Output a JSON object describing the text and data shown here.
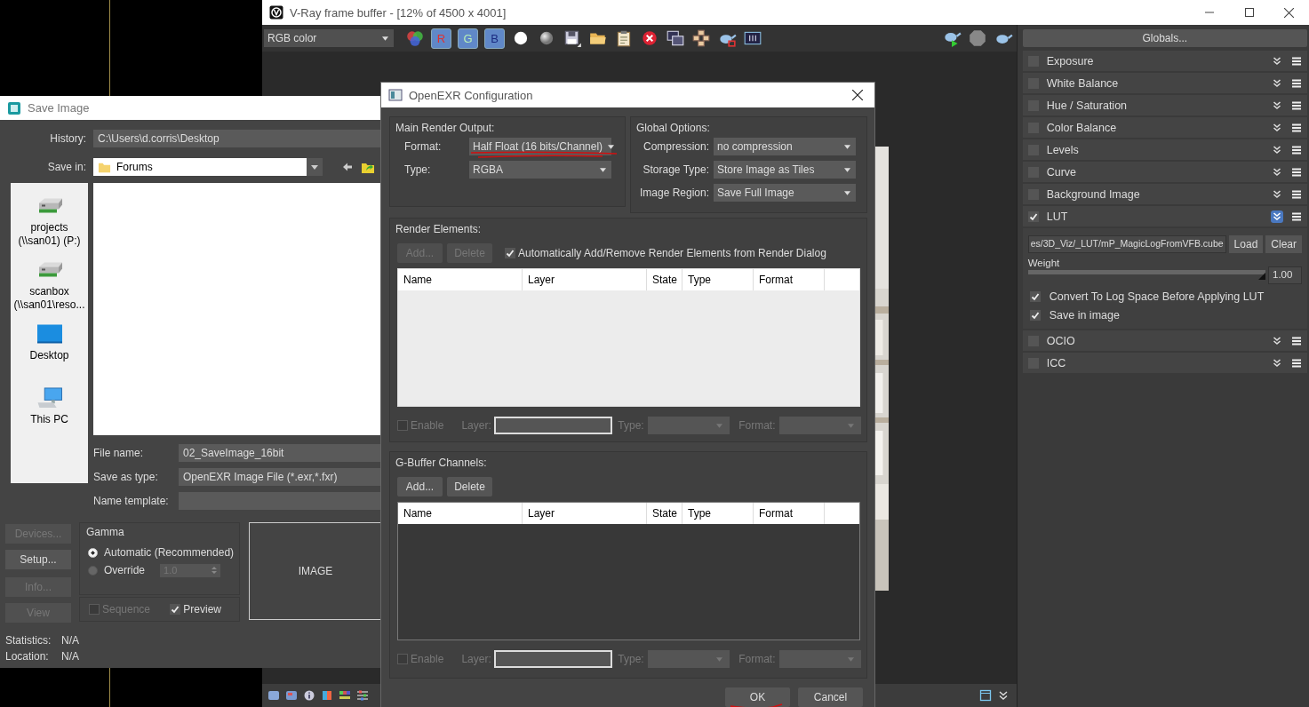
{
  "vfb": {
    "title": "V-Ray frame buffer - [12% of 4500 x 4001]",
    "channel_select": "RGB color",
    "channel_buttons": [
      {
        "label": "R",
        "selected": true
      },
      {
        "label": "G",
        "selected": true
      },
      {
        "label": "B",
        "selected": true
      }
    ],
    "globals_button": "Globals...",
    "layers": [
      {
        "label": "Exposure",
        "checked": false,
        "expanded": false
      },
      {
        "label": "White Balance",
        "checked": false,
        "expanded": false
      },
      {
        "label": "Hue / Saturation",
        "checked": false,
        "expanded": false
      },
      {
        "label": "Color Balance",
        "checked": false,
        "expanded": false
      },
      {
        "label": "Levels",
        "checked": false,
        "expanded": false
      },
      {
        "label": "Curve",
        "checked": false,
        "expanded": false
      },
      {
        "label": "Background Image",
        "checked": false,
        "expanded": false
      },
      {
        "label": "LUT",
        "checked": true,
        "expanded": true
      },
      {
        "label": "OCIO",
        "checked": false,
        "expanded": false
      },
      {
        "label": "ICC",
        "checked": false,
        "expanded": false
      }
    ],
    "lut": {
      "path": "es/3D_Viz/_LUT/mP_MagicLogFromVFB.cube",
      "load": "Load",
      "clear": "Clear",
      "weight_label": "Weight",
      "level": 1.0,
      "weight_value": "1.00",
      "options": [
        {
          "label": "Convert To Log Space Before Applying LUT",
          "checked": true
        },
        {
          "label": "Save in image",
          "checked": true
        }
      ]
    }
  },
  "save_image": {
    "title": "Save Image",
    "history_label": "History:",
    "history": "C:\\Users\\d.corris\\Desktop",
    "save_in_label": "Save in:",
    "save_in": "Forums",
    "places": [
      {
        "kind": "drive",
        "label": "projects",
        "sublabel": "(\\\\san01) (P:)"
      },
      {
        "kind": "drive",
        "label": "scanbox",
        "sublabel": "(\\\\san01\\reso..."
      },
      {
        "kind": "desktop",
        "label": "Desktop"
      },
      {
        "kind": "pc",
        "label": "This PC"
      }
    ],
    "file_name_label": "File name:",
    "file_name": "02_SaveImage_16bit",
    "save_as_type_label": "Save as type:",
    "save_as_type": "OpenEXR Image File (*.exr,*.fxr)",
    "name_template_label": "Name template:",
    "side_buttons": [
      {
        "label": "Devices...",
        "disabled": true
      },
      {
        "label": "Setup...",
        "disabled": false
      },
      {
        "label": "Info...",
        "disabled": true
      },
      {
        "label": "View",
        "disabled": true
      }
    ],
    "gamma": {
      "title": "Gamma",
      "options": [
        {
          "label": "Automatic (Recommended)",
          "selected": true
        },
        {
          "label": "Override",
          "selected": false
        }
      ],
      "override_value": "1.0"
    },
    "sequence": {
      "label": "Sequence",
      "checked": false,
      "disabled": true
    },
    "preview": {
      "label": "Preview",
      "checked": true,
      "disabled": false
    },
    "image_preview": "IMAGE",
    "info": [
      {
        "label": "Statistics:",
        "value": "N/A"
      },
      {
        "label": "Location:",
        "value": "N/A"
      }
    ]
  },
  "openexr": {
    "title": "OpenEXR Configuration",
    "main_output": {
      "title": "Main Render Output:",
      "fields": [
        {
          "label": "Format:",
          "value": "Half Float (16 bits/Channel)",
          "marked": true
        },
        {
          "label": "Type:",
          "value": "RGBA",
          "marked": false
        }
      ]
    },
    "global_options": {
      "title": "Global Options:",
      "fields": [
        {
          "label": "Compression:",
          "value": "no compression"
        },
        {
          "label": "Storage Type:",
          "value": "Store Image as Tiles"
        },
        {
          "label": "Image Region:",
          "value": "Save Full Image"
        }
      ]
    },
    "sections": [
      {
        "kind": "elements",
        "title": "Render Elements:",
        "buttons": [
          {
            "label": "Add...",
            "disabled": true
          },
          {
            "label": "Delete",
            "disabled": true
          }
        ],
        "auto_add": {
          "label": "Automatically Add/Remove Render Elements from Render Dialog",
          "checked": true
        },
        "columns": [
          "Name",
          "Layer",
          "State",
          "Type",
          "Format"
        ],
        "editor": {
          "enable": "Enable",
          "enable_checked": false,
          "layer_label": "Layer:",
          "type_label": "Type:",
          "format_label": "Format:"
        }
      },
      {
        "kind": "gbuffer",
        "title": "G-Buffer Channels:",
        "buttons": [
          {
            "label": "Add...",
            "disabled": false
          },
          {
            "label": "Delete",
            "disabled": false
          }
        ],
        "columns": [
          "Name",
          "Layer",
          "State",
          "Type",
          "Format"
        ],
        "editor": {
          "enable": "Enable",
          "enable_checked": false,
          "layer_label": "Layer:",
          "type_label": "Type:",
          "format_label": "Format:"
        }
      }
    ],
    "buttons": [
      {
        "label": "OK",
        "marked": true
      },
      {
        "label": "Cancel",
        "marked": false
      }
    ]
  }
}
